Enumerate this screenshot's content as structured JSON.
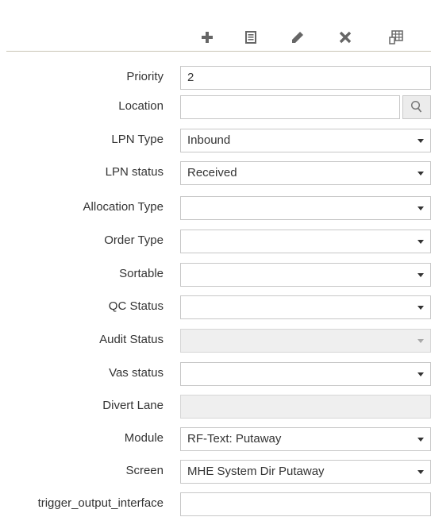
{
  "toolbar": {
    "buttons": [
      {
        "name": "add",
        "icon": "plus-icon"
      },
      {
        "name": "details",
        "icon": "list-icon"
      },
      {
        "name": "edit",
        "icon": "pencil-icon"
      },
      {
        "name": "delete",
        "icon": "x-icon"
      },
      {
        "name": "more",
        "icon": "grid-table-icon"
      }
    ]
  },
  "form": {
    "priority": {
      "label": "Priority",
      "value": "2"
    },
    "location": {
      "label": "Location",
      "value": ""
    },
    "lpn_type": {
      "label": "LPN Type",
      "value": "Inbound"
    },
    "lpn_status": {
      "label": "LPN status",
      "value": "Received"
    },
    "allocation_type": {
      "label": "Allocation Type",
      "value": ""
    },
    "order_type": {
      "label": "Order Type",
      "value": ""
    },
    "sortable": {
      "label": "Sortable",
      "value": ""
    },
    "qc_status": {
      "label": "QC Status",
      "value": ""
    },
    "audit_status": {
      "label": "Audit Status",
      "value": ""
    },
    "vas_status": {
      "label": "Vas status",
      "value": ""
    },
    "divert_lane": {
      "label": "Divert Lane",
      "value": ""
    },
    "module": {
      "label": "Module",
      "value": "RF-Text: Putaway"
    },
    "screen": {
      "label": "Screen",
      "value": "MHE System Dir Putaway"
    },
    "trigger_output_interface": {
      "label": "trigger_output_interface",
      "value": ""
    }
  },
  "colors": {
    "text": "#333333",
    "toolbar_icon": "#666666",
    "border": "#c7c7c7",
    "disabled_bg": "#efefef"
  }
}
